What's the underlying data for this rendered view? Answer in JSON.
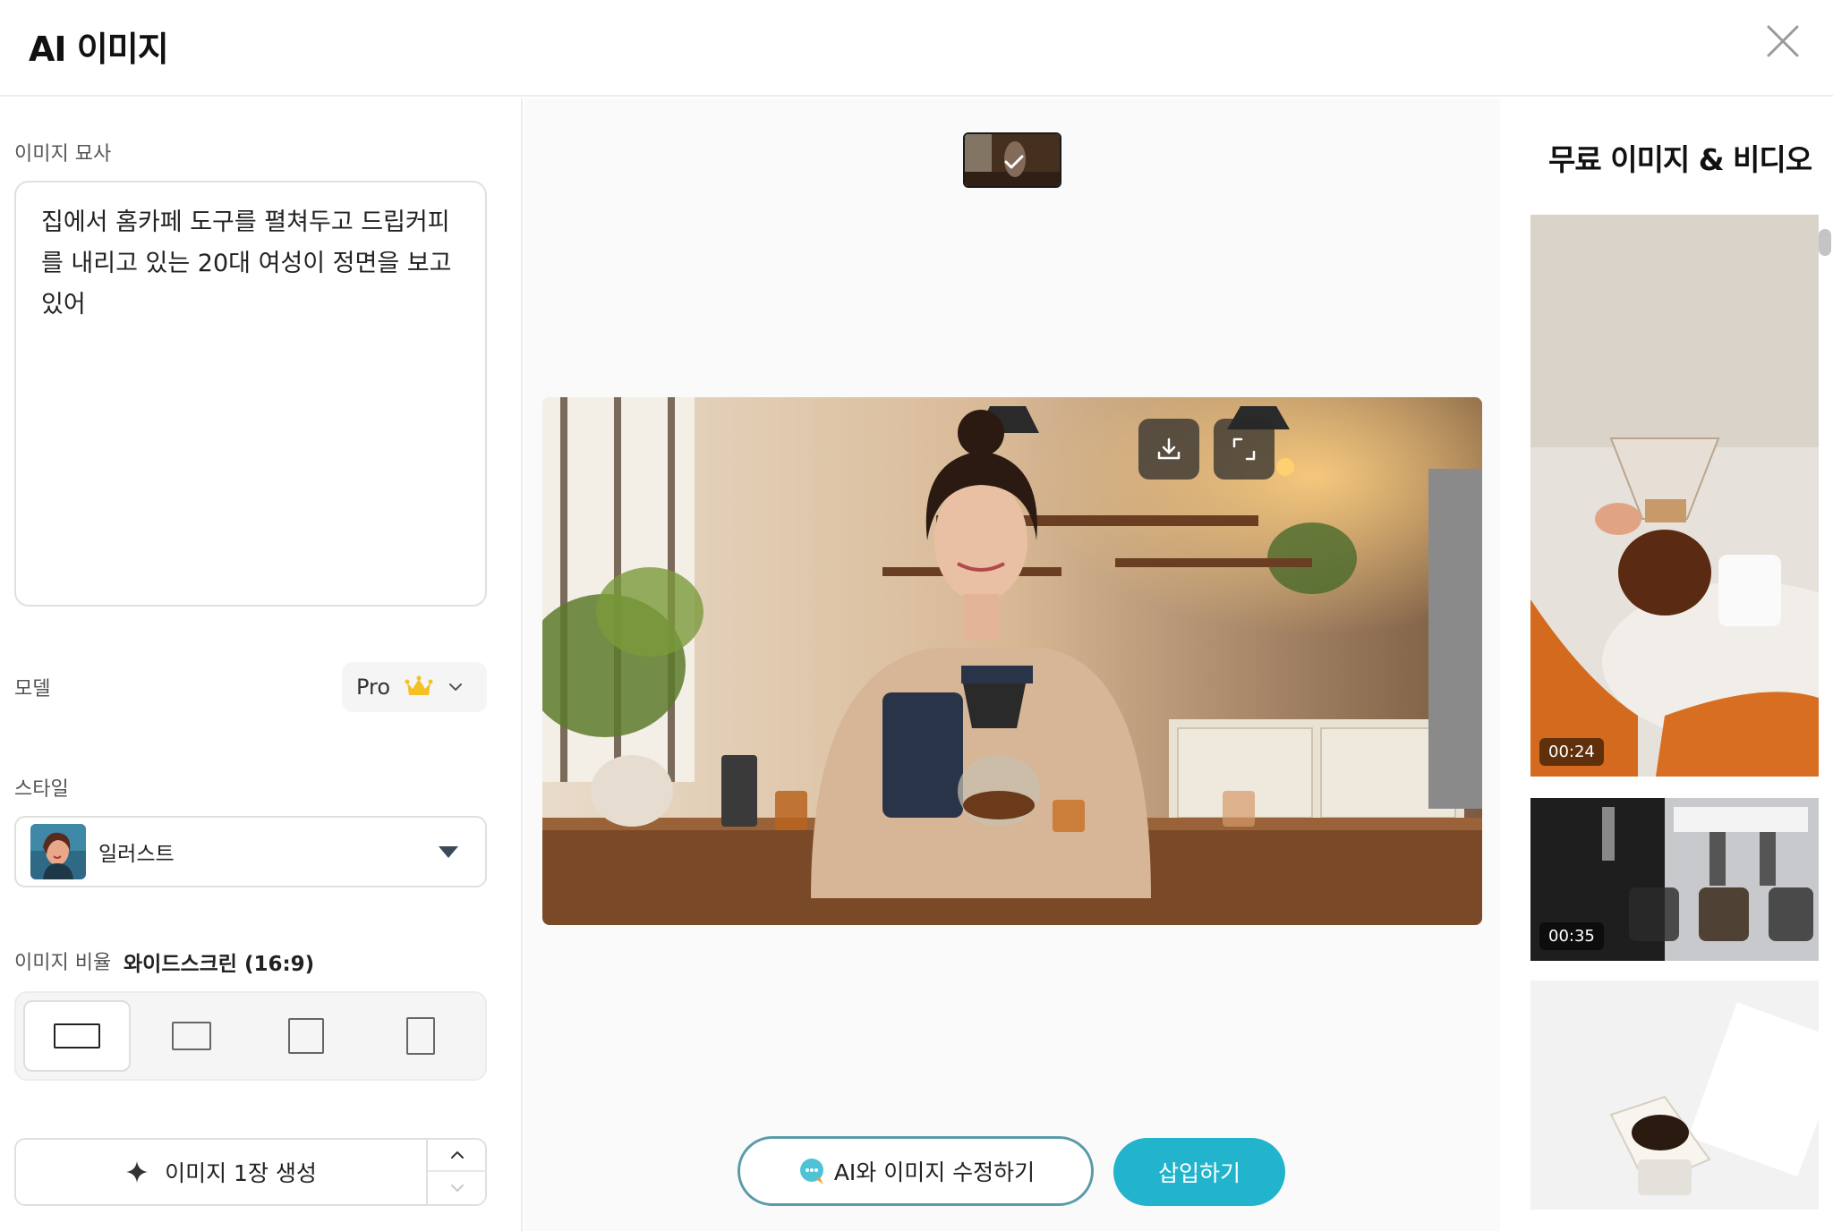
{
  "header": {
    "title": "AI 이미지"
  },
  "left": {
    "description_label": "이미지 묘사",
    "description_value": "집에서 홈카페 도구를 펼쳐두고 드립커피를 내리고 있는 20대 여성이 정면을 보고 있어",
    "model_label": "모델",
    "model_value": "Pro",
    "style_label": "스타일",
    "style_value": "일러스트",
    "ratio_label": "이미지 비율",
    "ratio_value": "와이드스크린 (16:9)",
    "ratio_options": [
      "16:9",
      "4:3",
      "1:1",
      "3:4"
    ],
    "ratio_selected": "16:9",
    "generate_label": "이미지 1장 생성"
  },
  "center": {
    "edit_label": "AI와 이미지 수정하기",
    "insert_label": "삽입하기"
  },
  "right": {
    "title": "무료 이미지 & 비디오",
    "items": [
      {
        "duration": "00:24"
      },
      {
        "duration": "00:35"
      },
      {
        "duration": ""
      }
    ]
  },
  "colors": {
    "accent": "#22b4cc",
    "edit_border": "#5a9aaa"
  },
  "icons": [
    "close-icon",
    "crown-icon",
    "chevron-down-icon",
    "caret-down-icon",
    "sparkle-icon",
    "chevron-up-icon",
    "download-icon",
    "fullscreen-icon",
    "check-icon",
    "ai-chat-icon"
  ]
}
